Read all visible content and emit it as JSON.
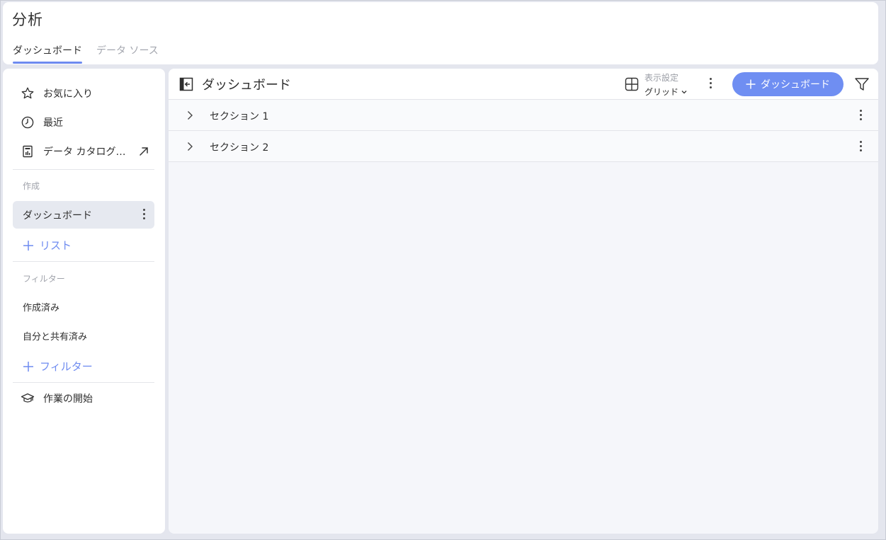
{
  "header": {
    "title": "分析",
    "tabs": [
      {
        "label": "ダッシュボード",
        "active": true
      },
      {
        "label": "データ ソース",
        "active": false
      }
    ]
  },
  "sidebar": {
    "nav": [
      {
        "label": "お気に入り",
        "icon": "star-icon"
      },
      {
        "label": "最近",
        "icon": "clock-icon"
      },
      {
        "label": "データ カタログ…",
        "icon": "catalog-icon",
        "external": true
      }
    ],
    "create_label": "作成",
    "selected_item": "ダッシュボード",
    "add_list": "リスト",
    "filter_label": "フィルター",
    "filters": [
      "作成済み",
      "自分と共有済み"
    ],
    "add_filter": "フィルター",
    "getting_started": "作業の開始"
  },
  "main": {
    "title": "ダッシュボード",
    "view_settings_label": "表示設定",
    "view_settings_value": "グリッド",
    "new_button": "ダッシュボード",
    "sections": [
      "セクション 1",
      "セクション 2"
    ]
  },
  "colors": {
    "accent": "#6f8ef2",
    "background": "#e4e6ee",
    "selected": "#e6e9f0"
  }
}
